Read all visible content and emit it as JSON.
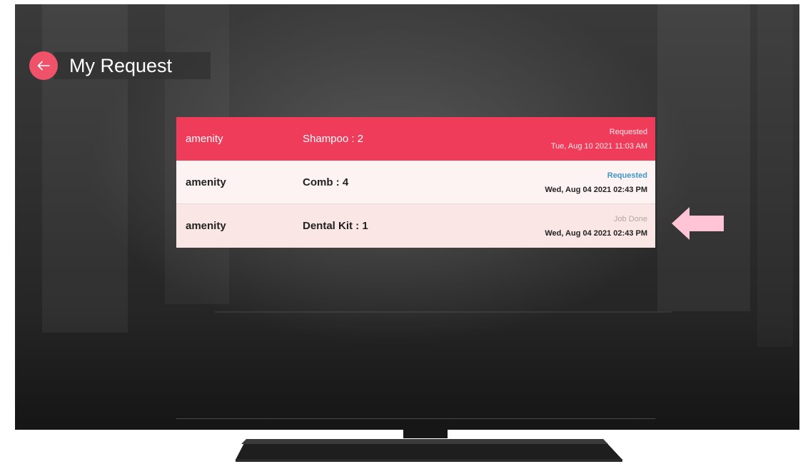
{
  "header": {
    "title": "My Request",
    "back_icon": "arrow-left-icon"
  },
  "requests": [
    {
      "category": "amenity",
      "item": "Shampoo : 2",
      "status": "Requested",
      "date": "Tue, Aug 10 2021 11:03 AM",
      "selected": true
    },
    {
      "category": "amenity",
      "item": "Comb : 4",
      "status": "Requested",
      "date": "Wed, Aug 04 2021 02:43 PM",
      "selected": false
    },
    {
      "category": "amenity",
      "item": "Dental Kit : 1",
      "status": "Job Done",
      "date": "Wed, Aug 04 2021 02:43 PM",
      "selected": false
    }
  ],
  "colors": {
    "accent": "#ee3c5a",
    "requested_status": "#3d97c9",
    "done_status": "#b0a8a6",
    "pointer_arrow": "#ffc4d6"
  },
  "annotation": {
    "icon": "pointer-arrow-icon"
  }
}
